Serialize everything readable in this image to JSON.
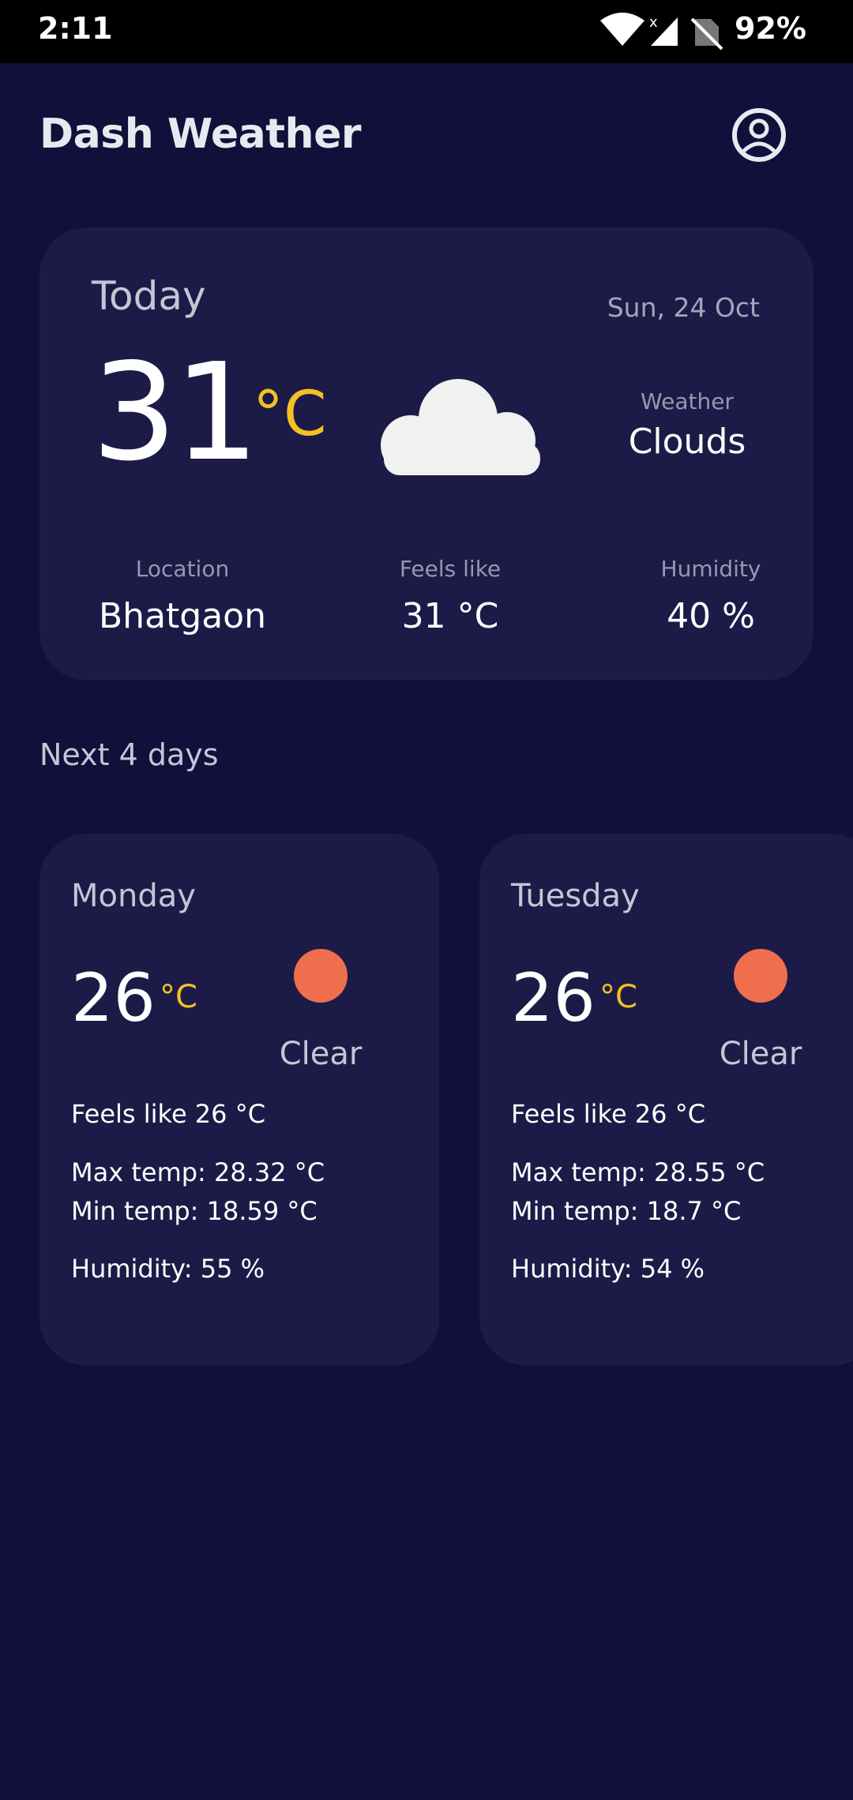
{
  "status_bar": {
    "time": "2:11",
    "battery": "92%"
  },
  "app": {
    "title": "Dash Weather"
  },
  "today": {
    "title": "Today",
    "date": "Sun, 24 Oct",
    "temperature": "31",
    "unit": "°C",
    "weather_label": "Weather",
    "weather": "Clouds",
    "location_label": "Location",
    "location": "Bhatgaon",
    "feels_like_label": "Feels like",
    "feels_like": "31 °C",
    "humidity_label": "Humidity",
    "humidity": "40 %"
  },
  "forecast": {
    "title": "Next 4 days",
    "days": [
      {
        "name": "Monday",
        "temp": "26",
        "unit": "°C",
        "condition": "Clear",
        "feels_like": "Feels like 26 °C",
        "max_temp": "Max temp: 28.32 °C",
        "min_temp": "Min temp: 18.59 °C",
        "humidity": "Humidity: 55 %"
      },
      {
        "name": "Tuesday",
        "temp": "26",
        "unit": "°C",
        "condition": "Clear",
        "feels_like": "Feels like 26 °C",
        "max_temp": "Max temp: 28.55 °C",
        "min_temp": "Min temp: 18.7 °C",
        "humidity": "Humidity: 54 %"
      }
    ]
  },
  "colors": {
    "background": "#11103a",
    "card": "#1c1b47",
    "accent_yellow": "#f5c023",
    "sun": "#ee6e4e"
  },
  "icons": {
    "profile": "account-circle-icon",
    "cloud": "cloud-icon",
    "sun": "sun-icon",
    "wifi": "wifi-icon",
    "signal": "signal-icon",
    "no_sim": "no-sim-icon"
  }
}
